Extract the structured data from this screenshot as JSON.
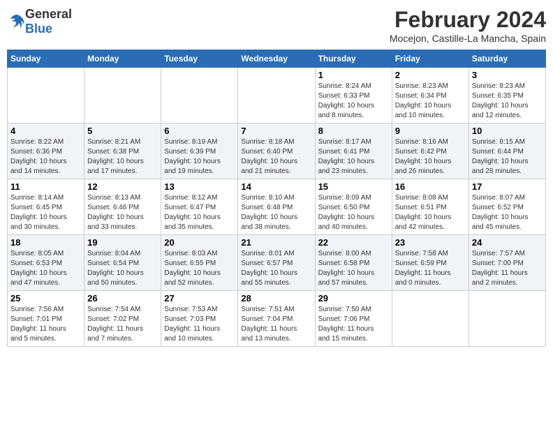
{
  "logo": {
    "general": "General",
    "blue": "Blue"
  },
  "title": "February 2024",
  "subtitle": "Mocejon, Castille-La Mancha, Spain",
  "days_of_week": [
    "Sunday",
    "Monday",
    "Tuesday",
    "Wednesday",
    "Thursday",
    "Friday",
    "Saturday"
  ],
  "weeks": [
    {
      "shaded": false,
      "days": [
        {
          "num": "",
          "info": ""
        },
        {
          "num": "",
          "info": ""
        },
        {
          "num": "",
          "info": ""
        },
        {
          "num": "",
          "info": ""
        },
        {
          "num": "1",
          "info": "Sunrise: 8:24 AM\nSunset: 6:33 PM\nDaylight: 10 hours\nand 8 minutes."
        },
        {
          "num": "2",
          "info": "Sunrise: 8:23 AM\nSunset: 6:34 PM\nDaylight: 10 hours\nand 10 minutes."
        },
        {
          "num": "3",
          "info": "Sunrise: 8:23 AM\nSunset: 6:35 PM\nDaylight: 10 hours\nand 12 minutes."
        }
      ]
    },
    {
      "shaded": true,
      "days": [
        {
          "num": "4",
          "info": "Sunrise: 8:22 AM\nSunset: 6:36 PM\nDaylight: 10 hours\nand 14 minutes."
        },
        {
          "num": "5",
          "info": "Sunrise: 8:21 AM\nSunset: 6:38 PM\nDaylight: 10 hours\nand 17 minutes."
        },
        {
          "num": "6",
          "info": "Sunrise: 8:19 AM\nSunset: 6:39 PM\nDaylight: 10 hours\nand 19 minutes."
        },
        {
          "num": "7",
          "info": "Sunrise: 8:18 AM\nSunset: 6:40 PM\nDaylight: 10 hours\nand 21 minutes."
        },
        {
          "num": "8",
          "info": "Sunrise: 8:17 AM\nSunset: 6:41 PM\nDaylight: 10 hours\nand 23 minutes."
        },
        {
          "num": "9",
          "info": "Sunrise: 8:16 AM\nSunset: 6:42 PM\nDaylight: 10 hours\nand 26 minutes."
        },
        {
          "num": "10",
          "info": "Sunrise: 8:15 AM\nSunset: 6:44 PM\nDaylight: 10 hours\nand 28 minutes."
        }
      ]
    },
    {
      "shaded": false,
      "days": [
        {
          "num": "11",
          "info": "Sunrise: 8:14 AM\nSunset: 6:45 PM\nDaylight: 10 hours\nand 30 minutes."
        },
        {
          "num": "12",
          "info": "Sunrise: 8:13 AM\nSunset: 6:46 PM\nDaylight: 10 hours\nand 33 minutes."
        },
        {
          "num": "13",
          "info": "Sunrise: 8:12 AM\nSunset: 6:47 PM\nDaylight: 10 hours\nand 35 minutes."
        },
        {
          "num": "14",
          "info": "Sunrise: 8:10 AM\nSunset: 6:48 PM\nDaylight: 10 hours\nand 38 minutes."
        },
        {
          "num": "15",
          "info": "Sunrise: 8:09 AM\nSunset: 6:50 PM\nDaylight: 10 hours\nand 40 minutes."
        },
        {
          "num": "16",
          "info": "Sunrise: 8:08 AM\nSunset: 6:51 PM\nDaylight: 10 hours\nand 42 minutes."
        },
        {
          "num": "17",
          "info": "Sunrise: 8:07 AM\nSunset: 6:52 PM\nDaylight: 10 hours\nand 45 minutes."
        }
      ]
    },
    {
      "shaded": true,
      "days": [
        {
          "num": "18",
          "info": "Sunrise: 8:05 AM\nSunset: 6:53 PM\nDaylight: 10 hours\nand 47 minutes."
        },
        {
          "num": "19",
          "info": "Sunrise: 8:04 AM\nSunset: 6:54 PM\nDaylight: 10 hours\nand 50 minutes."
        },
        {
          "num": "20",
          "info": "Sunrise: 8:03 AM\nSunset: 6:55 PM\nDaylight: 10 hours\nand 52 minutes."
        },
        {
          "num": "21",
          "info": "Sunrise: 8:01 AM\nSunset: 6:57 PM\nDaylight: 10 hours\nand 55 minutes."
        },
        {
          "num": "22",
          "info": "Sunrise: 8:00 AM\nSunset: 6:58 PM\nDaylight: 10 hours\nand 57 minutes."
        },
        {
          "num": "23",
          "info": "Sunrise: 7:58 AM\nSunset: 6:59 PM\nDaylight: 11 hours\nand 0 minutes."
        },
        {
          "num": "24",
          "info": "Sunrise: 7:57 AM\nSunset: 7:00 PM\nDaylight: 11 hours\nand 2 minutes."
        }
      ]
    },
    {
      "shaded": false,
      "days": [
        {
          "num": "25",
          "info": "Sunrise: 7:56 AM\nSunset: 7:01 PM\nDaylight: 11 hours\nand 5 minutes."
        },
        {
          "num": "26",
          "info": "Sunrise: 7:54 AM\nSunset: 7:02 PM\nDaylight: 11 hours\nand 7 minutes."
        },
        {
          "num": "27",
          "info": "Sunrise: 7:53 AM\nSunset: 7:03 PM\nDaylight: 11 hours\nand 10 minutes."
        },
        {
          "num": "28",
          "info": "Sunrise: 7:51 AM\nSunset: 7:04 PM\nDaylight: 11 hours\nand 13 minutes."
        },
        {
          "num": "29",
          "info": "Sunrise: 7:50 AM\nSunset: 7:06 PM\nDaylight: 11 hours\nand 15 minutes."
        },
        {
          "num": "",
          "info": ""
        },
        {
          "num": "",
          "info": ""
        }
      ]
    }
  ]
}
